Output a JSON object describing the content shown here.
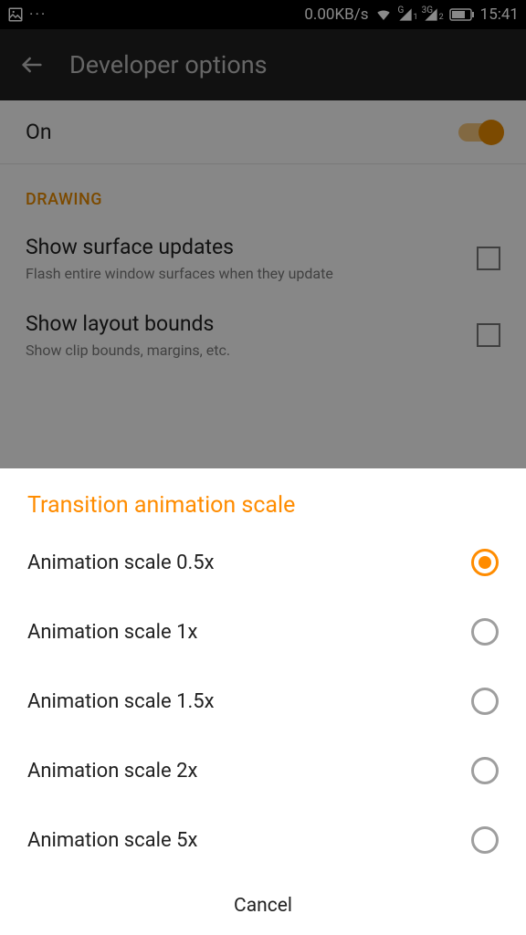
{
  "statusbar": {
    "data_rate": "0.00KB/s",
    "time": "15:41",
    "signal_label_1": "G",
    "signal_label_2": "3G",
    "signal_sub_1": "1",
    "signal_sub_2": "2"
  },
  "appbar": {
    "title": "Developer options"
  },
  "master": {
    "label": "On"
  },
  "section": {
    "drawing": "DRAWING"
  },
  "prefs": {
    "surface": {
      "title": "Show surface updates",
      "summary": "Flash entire window surfaces when they update"
    },
    "layout": {
      "title": "Show layout bounds",
      "summary": "Show clip bounds, margins, etc."
    }
  },
  "dialog": {
    "title": "Transition animation scale",
    "cancel": "Cancel",
    "options": {
      "o0": "Animation scale 0.5x",
      "o1": "Animation scale 1x",
      "o2": "Animation scale 1.5x",
      "o3": "Animation scale 2x",
      "o4": "Animation scale 5x"
    },
    "selected_index": 0
  }
}
